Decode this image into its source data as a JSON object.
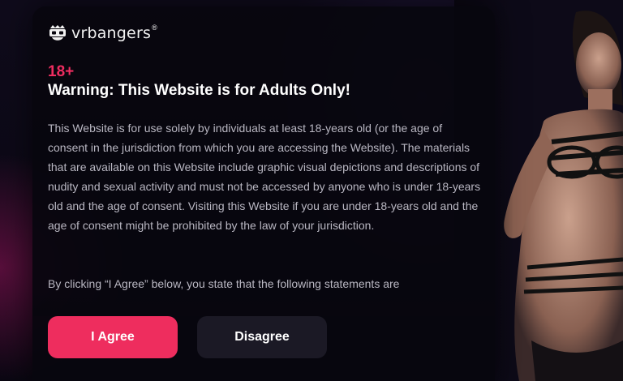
{
  "brand": {
    "name": "vrbangers",
    "registered_mark": "®",
    "logo_icon": "vr-headset-mascot-icon"
  },
  "modal": {
    "age_badge": "18+",
    "title": "Warning: This Website is for Adults Only!",
    "paragraph_1": "This Website is for use solely by individuals at least 18-years old (or the age of consent in the jurisdiction from which you are accessing the Website). The materials that are available on this Website include graphic visual depictions and descriptions of nudity and sexual activity and must not be accessed by anyone who is under 18-years old and the age of consent. Visiting this Website if you are under 18-years old and the age of consent might be prohibited by the law of your jurisdiction.",
    "paragraph_2": "By clicking “I Agree” below, you state that the following statements are"
  },
  "actions": {
    "agree_label": "I Agree",
    "disagree_label": "Disagree"
  },
  "colors": {
    "accent": "#ee2d5e",
    "background": "#0a0712",
    "modal_background": "#08060e",
    "secondary_button": "#1b1925",
    "body_text": "#b9b7c2"
  }
}
